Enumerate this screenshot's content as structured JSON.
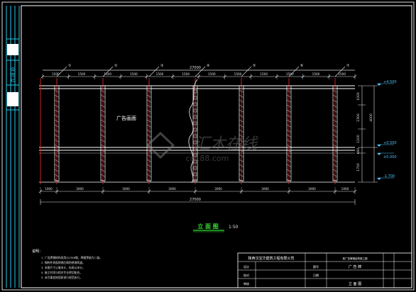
{
  "drawing": {
    "background": "#000000",
    "frame_color": "#ffffff",
    "column_color": "#cc2222",
    "dim_color": "#e0e0e0",
    "level_color": "#4fc3f7",
    "title_color": "#33dd33",
    "watermark_color": "#555555",
    "top_dimensions": [
      "1500",
      "1500",
      "1500",
      "1500",
      "1500",
      "1500",
      "1500",
      "1500",
      "1500",
      "1500",
      "1500",
      "1500"
    ],
    "top_total": "27000",
    "axis_marks": [
      "①",
      "②",
      "③",
      "④",
      "⑤",
      "⑥",
      "⑦"
    ],
    "bottom_dimensions": [
      "1000",
      "3000",
      "3000",
      "3000",
      "3000",
      "3000",
      "3000",
      "1000"
    ],
    "bottom_total": "27000",
    "right_dimensions": [
      "1000",
      "2300",
      "1100",
      "600",
      "1700"
    ],
    "right_total": "4000",
    "level_marks": [
      "+4.500",
      "+0.500",
      "±0.000",
      "-1.700"
    ],
    "panel_label": "广告画面",
    "view_title": "立 面 图",
    "view_scale": "1:50",
    "watermark_text": "汇木在线",
    "watermark_sub": "co188.com",
    "notes_title": "说明：",
    "notes": [
      "1. 广告牌钢结构采用Q235B钢，焊缝等级为二级。",
      "2. 钢构件表面除锈后刷防锈漆两道。",
      "3. 本图尺寸以毫米计，标高以米计。",
      "4. 施工时须与相关专业密切配合。",
      "5. 未尽事宜按国家现行规范执行。"
    ]
  },
  "title_block": {
    "company": "陕西汉宝华建筑工程有限公司",
    "project": "某广告牌钢结构施工图",
    "drawing_name": "立 面 图",
    "drawing_label": "广 告 牌",
    "design_label": "设计",
    "check_label": "校对",
    "approve_label": "审核",
    "sheet_label": "图号",
    "date_label": "日期"
  },
  "left_strip": {
    "labels": [
      "会",
      "签",
      "栏"
    ]
  }
}
